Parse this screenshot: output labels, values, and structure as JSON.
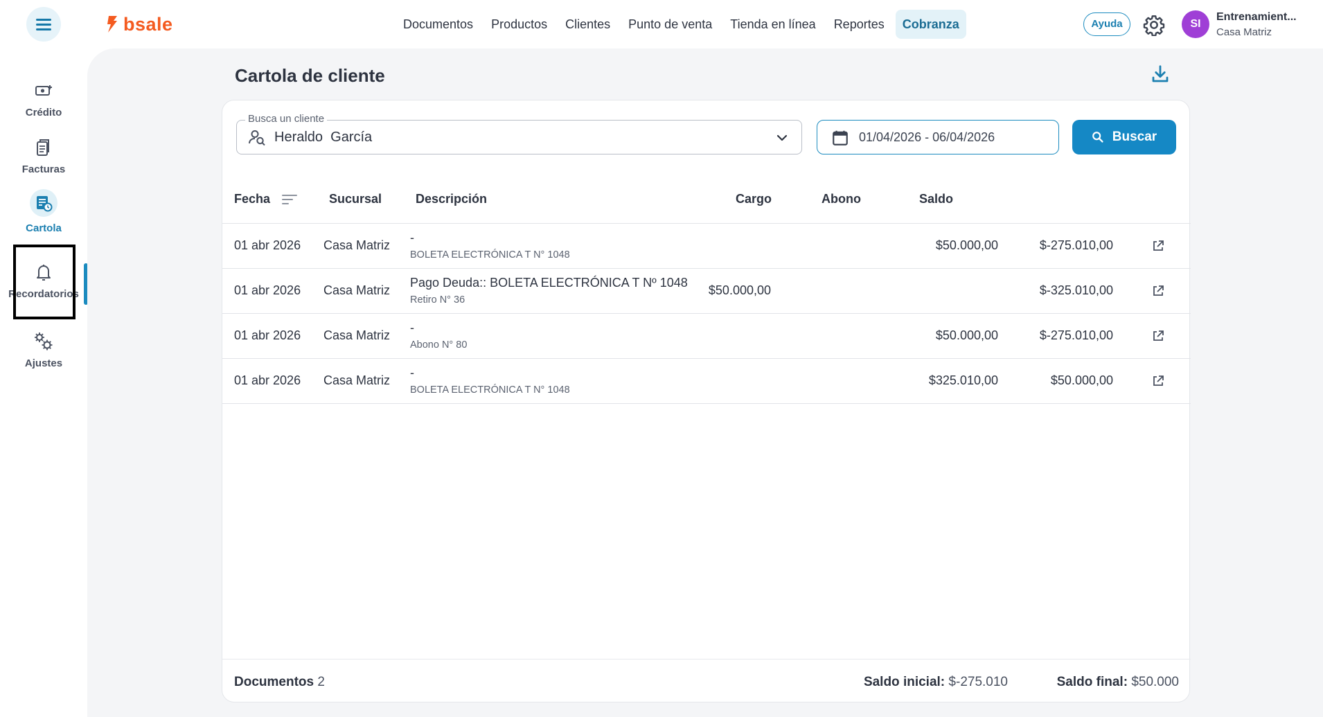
{
  "brand": {
    "name": "bsale",
    "color": "#f45b20",
    "accent": "#1b8bbf"
  },
  "topnav": {
    "items": [
      "Documentos",
      "Productos",
      "Clientes",
      "Punto de venta",
      "Tienda en línea",
      "Reportes",
      "Cobranza"
    ],
    "active": "Cobranza"
  },
  "header": {
    "help_label": "Ayuda",
    "avatar_initials": "SI",
    "user_name": "Entrenamient...",
    "user_branch": "Casa Matriz"
  },
  "sidebar": {
    "items": [
      {
        "label": "Crédito",
        "icon": "money-plus-icon"
      },
      {
        "label": "Facturas",
        "icon": "documents-icon"
      },
      {
        "label": "Cartola",
        "icon": "statement-clock-icon",
        "active": true
      },
      {
        "label": "Recordatorios",
        "icon": "bell-icon"
      },
      {
        "label": "Ajustes",
        "icon": "gears-icon"
      }
    ]
  },
  "page": {
    "title": "Cartola de cliente"
  },
  "filters": {
    "client_label": "Busca un cliente",
    "client_value": "Heraldo  García",
    "date_range": "01/04/2026 - 06/04/2026",
    "search_label": "Buscar"
  },
  "table": {
    "headers": {
      "fecha": "Fecha",
      "sucursal": "Sucursal",
      "descripcion": "Descripción",
      "cargo": "Cargo",
      "abono": "Abono",
      "saldo": "Saldo"
    },
    "rows": [
      {
        "fecha": "01 abr 2026",
        "sucursal": "Casa Matriz",
        "desc": "-",
        "sub": "BOLETA ELECTRÓNICA T N° 1048",
        "cargo": "",
        "abono": "$50.000,00",
        "saldo": "$-275.010,00"
      },
      {
        "fecha": "01 abr 2026",
        "sucursal": "Casa Matriz",
        "desc": "Pago Deuda:: BOLETA ELECTRÓNICA T Nº 1048",
        "sub": "Retiro N° 36",
        "cargo": "$50.000,00",
        "abono": "",
        "saldo": "$-325.010,00"
      },
      {
        "fecha": "01 abr 2026",
        "sucursal": "Casa Matriz",
        "desc": "-",
        "sub": "Abono N° 80",
        "cargo": "",
        "abono": "$50.000,00",
        "saldo": "$-275.010,00"
      },
      {
        "fecha": "01 abr 2026",
        "sucursal": "Casa Matriz",
        "desc": "-",
        "sub": "BOLETA ELECTRÓNICA T N° 1048",
        "cargo": "",
        "abono": "$325.010,00",
        "saldo": "$50.000,00"
      }
    ]
  },
  "footer": {
    "documents_label": "Documentos",
    "documents_count": "2",
    "saldo_inicial_label": "Saldo inicial:",
    "saldo_inicial_value": "$-275.010",
    "saldo_final_label": "Saldo final:",
    "saldo_final_value": "$50.000"
  }
}
